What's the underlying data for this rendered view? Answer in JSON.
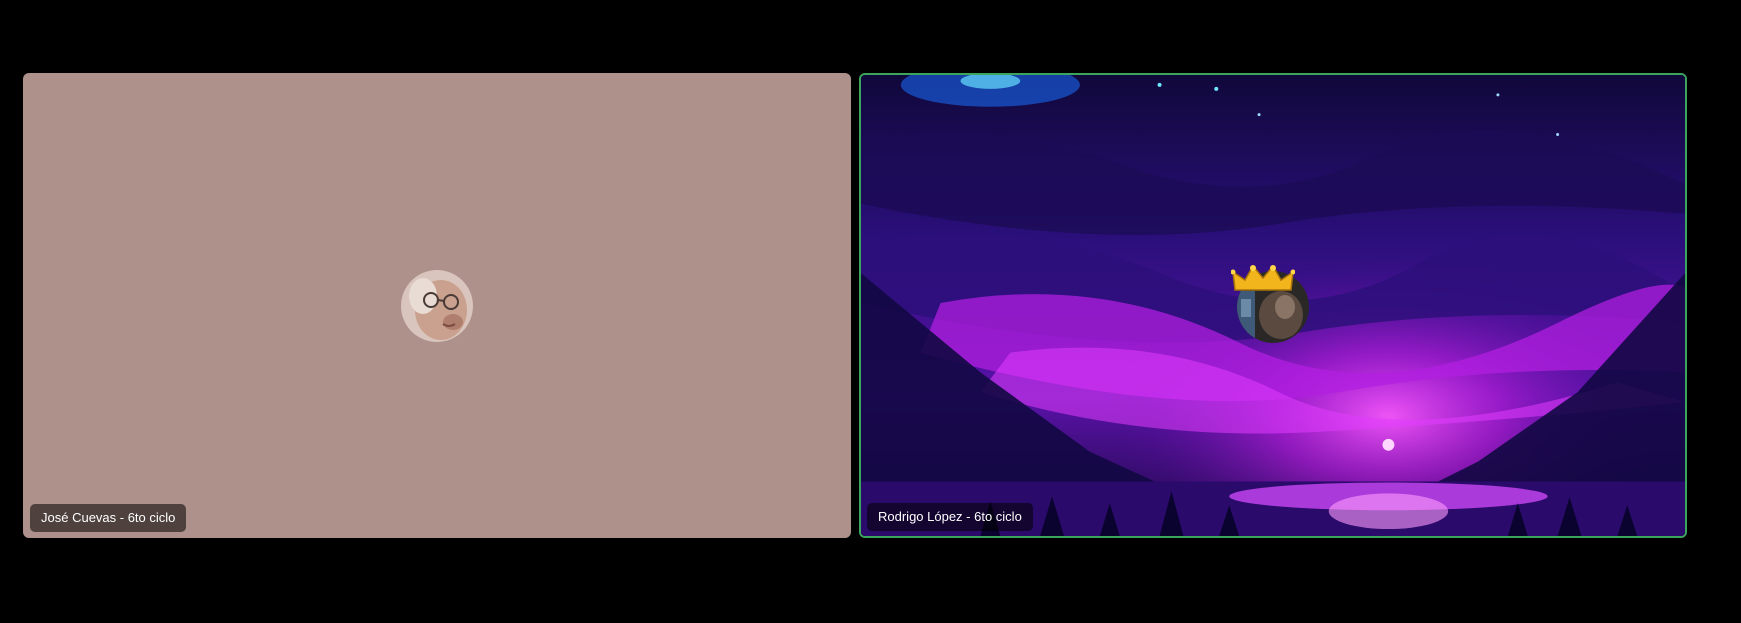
{
  "participants": [
    {
      "label": "José Cuevas - 6to ciclo",
      "tile_color": "#ad918a",
      "avatar": "profile-photo-glasses",
      "speaking": false
    },
    {
      "label": "Rodrigo López - 6to ciclo",
      "background": "pixel-art-purple-night-sky",
      "avatar": "profile-photo-dark",
      "avatar_decoration": "crown-icon",
      "speaking": true,
      "speaking_border_color": "#3ba55d"
    }
  ]
}
